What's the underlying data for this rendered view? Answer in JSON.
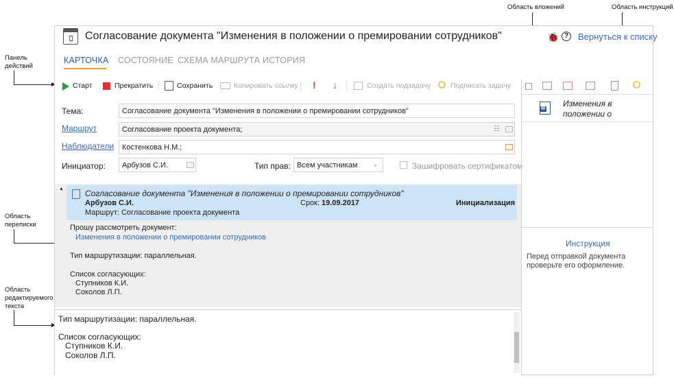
{
  "callouts": {
    "action_panel": "Панель\nдействий",
    "attachments_area": "Область вложений",
    "instructions_area": "Область инструкций",
    "correspondence_area": "Область\nпереписки",
    "editable_text_area": "Область\nредактируемого\nтекста"
  },
  "window": {
    "title": "Согласование документа \"Изменения в положении о премировании сотрудников\"",
    "back_link": "Вернуться к списку"
  },
  "tabs": [
    {
      "label": "КАРТОЧКА",
      "active": true
    },
    {
      "label": "СОСТОЯНИЕ",
      "active": false
    },
    {
      "label": "СХЕМА МАРШРУТА",
      "active": false
    },
    {
      "label": "ИСТОРИЯ",
      "active": false
    }
  ],
  "toolbar": {
    "start": "Старт",
    "stop": "Прекратить",
    "save": "Сохранить",
    "copy_link": "Копировать ссылку",
    "create_subtask": "Создать подзадачу",
    "sign_task": "Подписать задачу"
  },
  "form": {
    "subject_label": "Тема:",
    "subject_value": "Согласование документа \"Изменения в положении о премировании сотрудников\"",
    "route_label": "Маршрут",
    "route_value": "Согласование проекта документа;",
    "observers_label": "Наблюдатели",
    "observers_value": "Костенкова Н.М.;",
    "initiator_label": "Инициатор:",
    "initiator_value": "Арбузов С.И.",
    "rights_label": "Тип прав:",
    "rights_value": "Всем участникам",
    "encrypt_label": "Зашифровать сертификатом"
  },
  "message": {
    "title": "Согласование документа \"Изменения в положении о премировании сотрудников\"",
    "author": "Арбузов С.И.",
    "deadline_label": "Срок:",
    "deadline_value": "19.09.2017",
    "status": "Инициализация",
    "route_line": "Маршрут: Согласование проекта документа",
    "body_request": "Прошу рассмотреть документ:",
    "body_link": "Изменения в положении о премировании сотрудников",
    "body_routing": "Тип маршрутизации: параллельная.",
    "body_list_title": "Список согласующих:",
    "body_approver1": "Ступников К.И.",
    "body_approver2": "Соколов Л.П."
  },
  "editor": {
    "line1": "Тип маршрутизации: параллельная.",
    "line2": "Список согласующих:",
    "line3": "Ступников К.И.",
    "line4": "Соколов Л.П."
  },
  "attachments": {
    "file_name": "Изменения в\nположении о"
  },
  "instructions": {
    "title": "Инструкция",
    "text": "Перед отправкой документа\nпроверьте его оформление."
  }
}
